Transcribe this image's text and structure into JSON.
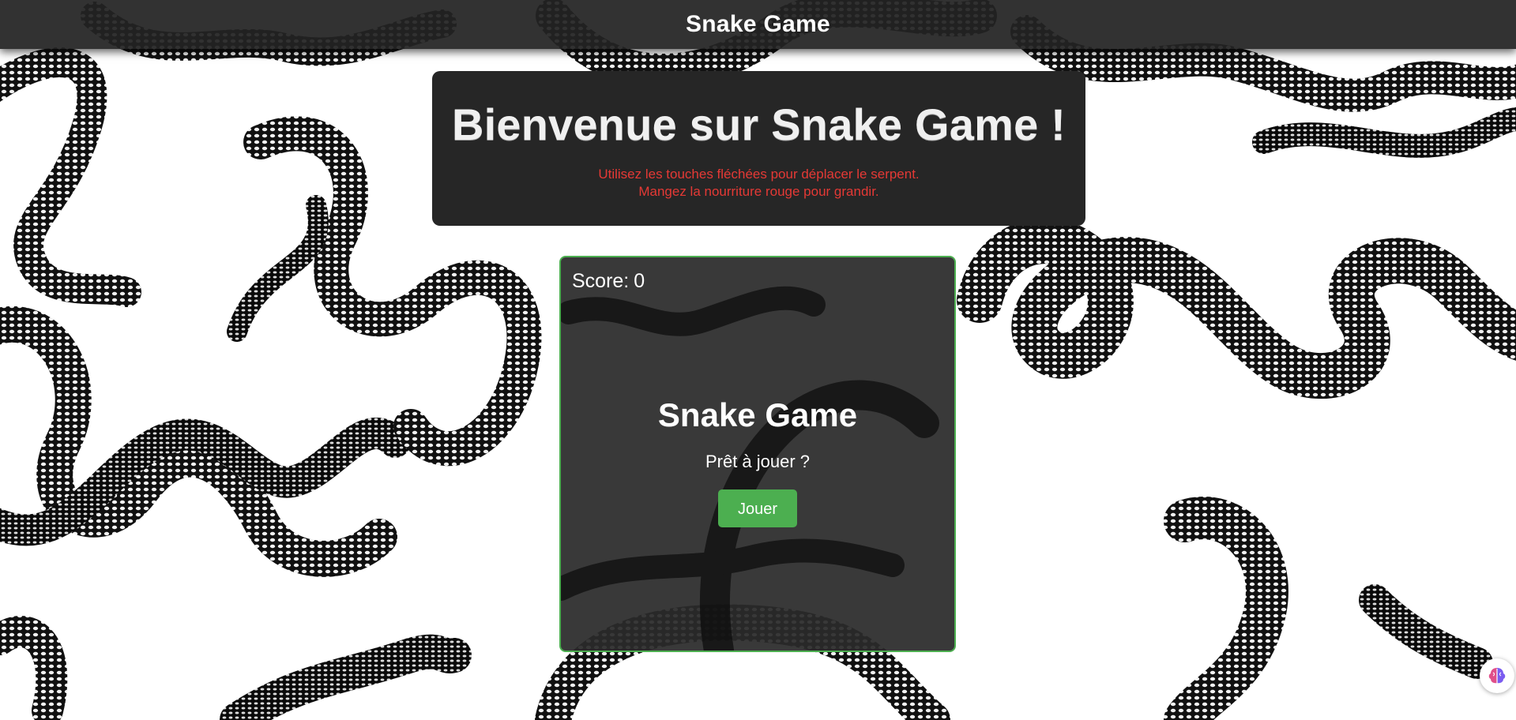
{
  "header": {
    "title": "Snake Game"
  },
  "welcome": {
    "title": "Bienvenue sur Snake Game !",
    "line1": "Utilisez les touches fléchées pour déplacer le serpent.",
    "line2": "Mangez la nourriture rouge pour grandir."
  },
  "game": {
    "score_label": "Score:",
    "score_value": "0",
    "overlay_title": "Snake Game",
    "overlay_subtitle": "Prêt à jouer ?",
    "play_label": "Jouer"
  },
  "colors": {
    "accent_green": "#4caf50",
    "instruction_red": "#e53935",
    "panel_dark": "#262626"
  },
  "icons": {
    "floating_assistant": "brain-icon"
  }
}
